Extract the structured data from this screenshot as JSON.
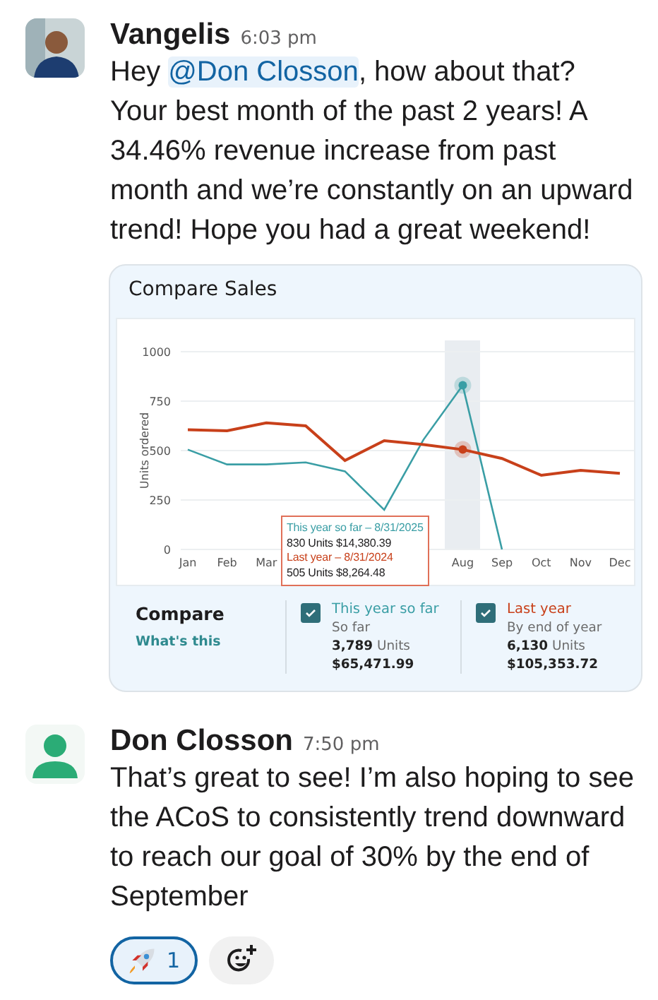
{
  "messages": [
    {
      "author": "Vangelis",
      "time": "6:03 pm",
      "parts": [
        {
          "kind": "text",
          "text": "Hey "
        },
        {
          "kind": "mention",
          "text": "@Don Closson"
        },
        {
          "kind": "text",
          "text": ", how about that? Your best month of the past 2 years! A 34.46% revenue increase from past month and we’re constantly on an upward trend! Hope you had a great weekend!"
        }
      ],
      "card": {
        "title": "Compare Sales",
        "chart_data": {
          "type": "line",
          "ylabel": "Units ordered",
          "categories": [
            "Jan",
            "Feb",
            "Mar",
            null,
            null,
            null,
            null,
            "Aug",
            "Sep",
            "Oct",
            "Nov",
            "Dec"
          ],
          "ylim": [
            0,
            1000
          ],
          "yticks": [
            0,
            250,
            500,
            750,
            1000
          ],
          "grid": true,
          "series": [
            {
              "name": "This year so far",
              "color": "#3a9ea5",
              "values": [
                505,
                430,
                430,
                440,
                395,
                200,
                555,
                830,
                0,
                null,
                null,
                null
              ]
            },
            {
              "name": "Last year",
              "color": "#c8401a",
              "values": [
                605,
                600,
                640,
                625,
                450,
                550,
                530,
                505,
                460,
                375,
                400,
                385
              ]
            }
          ]
        },
        "tooltip": [
          {
            "color": "#3a9ea5",
            "heading": "This year so far – 8/31/2025",
            "detail": "830 Units $14,380.39"
          },
          {
            "color": "#c8401a",
            "heading": "Last year – 8/31/2024",
            "detail": "505 Units $8,264.48"
          }
        ],
        "compare": {
          "title": "Compare",
          "link": "What's this"
        },
        "legend": [
          {
            "checked": true,
            "sub": "So far",
            "units": "**3,789** Units",
            "amount": "$65,471.99"
          },
          {
            "checked": true,
            "sub": "By end of year",
            "units": "**6,130** Units",
            "amount": "$105,353.72"
          }
        ]
      }
    },
    {
      "author": "Don Closson",
      "time": "7:50 pm",
      "avatar": {
        "kind": "icon"
      },
      "parts": [
        {
          "kind": "text",
          "text": "That’s great to see! I’m also hoping to see the ACoS to consistently trend downward to reach our goal of 30% by the end of September"
        }
      ],
      "reactions": [
        {
          "kind": "rocket",
          "count": "1",
          "selected": true
        },
        {
          "kind": "add"
        }
      ]
    }
  ]
}
